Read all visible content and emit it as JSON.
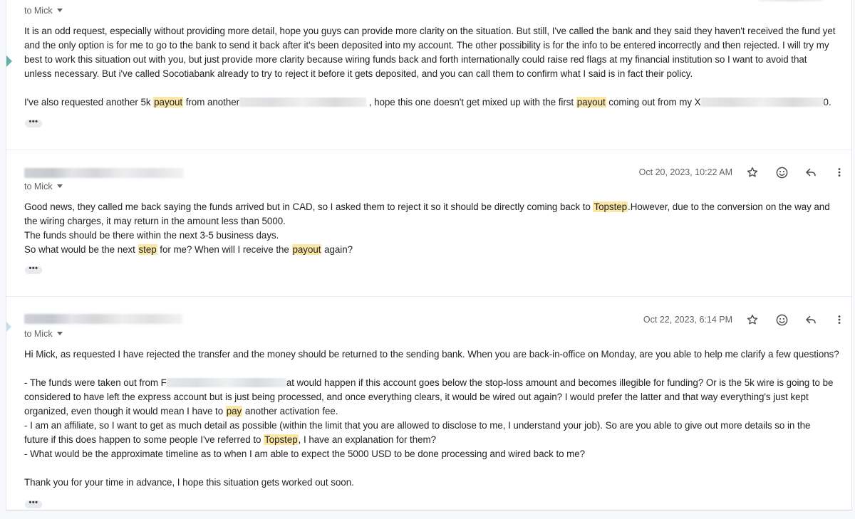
{
  "messages": [
    {
      "recipient": "to Mick",
      "paragraphs": [
        [
          {
            "t": "It is an odd request, especially without providing more detail, hope you guys can provide more clarity on the situation. But still, I've called the bank and they said they haven't received the fund yet"
          }
        ],
        [
          {
            "t": "and the only option is for me to go to the bank to send it back after it's been deposited into my account. The other possibility is for the info to be entered incorrectly and then rejected. I will try my"
          }
        ],
        [
          {
            "t": "best to work this situation out with you, but just provide more clarity because wiring funds back and forth internationally could raise red flags at my financial institution so I want to avoid that"
          }
        ],
        [
          {
            "t": "unless necessary.  But i've called Socotiabank already to try to reject it before it gets deposited, and you can call them to confirm what I said is in fact their policy."
          }
        ],
        "gap",
        [
          {
            "t": "I've also requested another 5k "
          },
          {
            "t": "payout",
            "h": true
          },
          {
            "t": " from another"
          },
          {
            "r": 178
          },
          {
            "t": " , hope this one doesn't get mixed up with the first "
          },
          {
            "t": "payout",
            "h": true
          },
          {
            "t": " coming out from my X"
          },
          {
            "r": 172
          },
          {
            "t": "0."
          }
        ]
      ],
      "more": "•••"
    },
    {
      "recipient": "to Mick",
      "date": "Oct 20, 2023, 10:22 AM",
      "paragraphs": [
        [
          {
            "t": "Good news, they called me back saying the funds arrived but in CAD, so I asked them to reject it so it should be directly coming back to "
          },
          {
            "t": "Topstep",
            "h": true
          },
          {
            "t": ".However, due to the conversion on the way and"
          }
        ],
        [
          {
            "t": "the wiring charges, it may return in the amount less than 5000."
          }
        ],
        [
          {
            "t": "The funds should be there within the next 3-5 business days."
          }
        ],
        [
          {
            "t": "So what would be the next "
          },
          {
            "t": "step",
            "h": true
          },
          {
            "t": " for me? When will I receive the "
          },
          {
            "t": "payout",
            "h": true
          },
          {
            "t": " again?"
          }
        ]
      ],
      "more": "•••"
    },
    {
      "recipient": "to Mick",
      "date": "Oct 22, 2023, 6:14 PM",
      "paragraphs": [
        [
          {
            "t": "Hi Mick, as requested I have rejected the transfer and the money should be returned to the sending bank. When you are back-in-office on Monday, are you able to help me clarify a few questions?"
          }
        ],
        "gap",
        [
          {
            "t": "- The funds were taken out from F"
          },
          {
            "r": 168
          },
          {
            "t": "at would happen if this account goes below the stop-loss amount and becomes illegible for funding? Or is the 5k wire is going to be"
          }
        ],
        [
          {
            "t": "considered to have left the express account but is just being processed, and once everything clears, it would be wired out again? I would prefer the latter and that way everything's just kept"
          }
        ],
        [
          {
            "t": "organized, even though it would mean I have to "
          },
          {
            "t": "pay",
            "h": true
          },
          {
            "t": " another activation fee."
          }
        ],
        [
          {
            "t": "- I am an affiliate, so I want to get as much detail as possible (within the limit that you are allowed to disclose to me, I understand your job). So are you able to give out more details so in the"
          }
        ],
        [
          {
            "t": "future if this does happen to some people I've referred to "
          },
          {
            "t": "Topstep",
            "h": true
          },
          {
            "t": ", I have an explanation for them?"
          }
        ],
        [
          {
            "t": "- What would be the approximate timeline as to when I am able to expect the 5000 USD to be done processing and wired back to me?"
          }
        ],
        "gap",
        [
          {
            "t": "Thank you for your time in advance, I hope this situation gets worked out soon."
          }
        ]
      ],
      "more": "•••"
    }
  ],
  "icons": [
    "star-icon",
    "emoji-reaction-icon",
    "reply-icon",
    "more-vert-icon"
  ],
  "colors": {
    "highlight": "#fbe8a6",
    "text": "#222222",
    "meta": "#5f6368"
  }
}
